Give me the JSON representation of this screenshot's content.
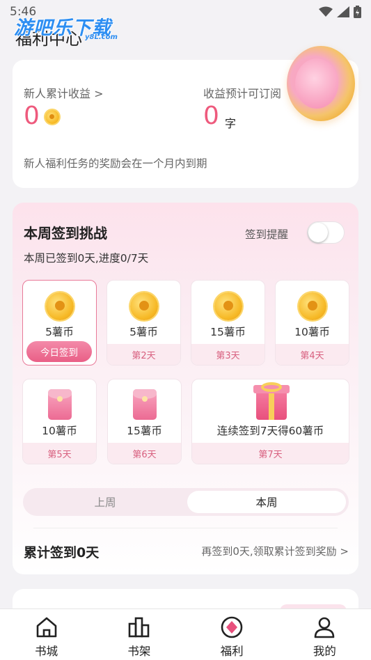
{
  "status_bar": {
    "time": "5:46"
  },
  "watermark": {
    "text": "游吧乐下载",
    "sub": "y8L.com"
  },
  "page": {
    "title": "福利中心"
  },
  "earnings": {
    "new_user_label": "新人累计收益 >",
    "new_user_value": "0",
    "forecast_label": "收益预计可订阅",
    "forecast_value": "0",
    "forecast_unit": "字",
    "hint": "新人福利任务的奖励会在一个月内到期"
  },
  "checkin": {
    "title": "本周签到挑战",
    "remind_label": "签到提醒",
    "remind_on": false,
    "progress": "本周已签到0天,进度0/7天",
    "days": [
      {
        "amount": "5薯币",
        "footer": "今日签到"
      },
      {
        "amount": "5薯币",
        "footer": "第2天"
      },
      {
        "amount": "15薯币",
        "footer": "第3天"
      },
      {
        "amount": "10薯币",
        "footer": "第4天"
      },
      {
        "amount": "10薯币",
        "footer": "第5天"
      },
      {
        "amount": "15薯币",
        "footer": "第6天"
      },
      {
        "amount": "连续签到7天得60薯币",
        "footer": "第7天"
      }
    ],
    "week_tabs": {
      "previous": "上周",
      "current": "本周"
    },
    "total_label": "累计签到0天",
    "total_link": "再签到0天,领取累计签到奖励 >"
  },
  "tabbar": [
    {
      "label": "书城",
      "icon": "home-icon"
    },
    {
      "label": "书架",
      "icon": "bookshelf-icon"
    },
    {
      "label": "福利",
      "icon": "welfare-icon"
    },
    {
      "label": "我的",
      "icon": "profile-icon"
    }
  ],
  "colors": {
    "accent": "#ee5a7d",
    "tab_active": "#e8507d"
  }
}
